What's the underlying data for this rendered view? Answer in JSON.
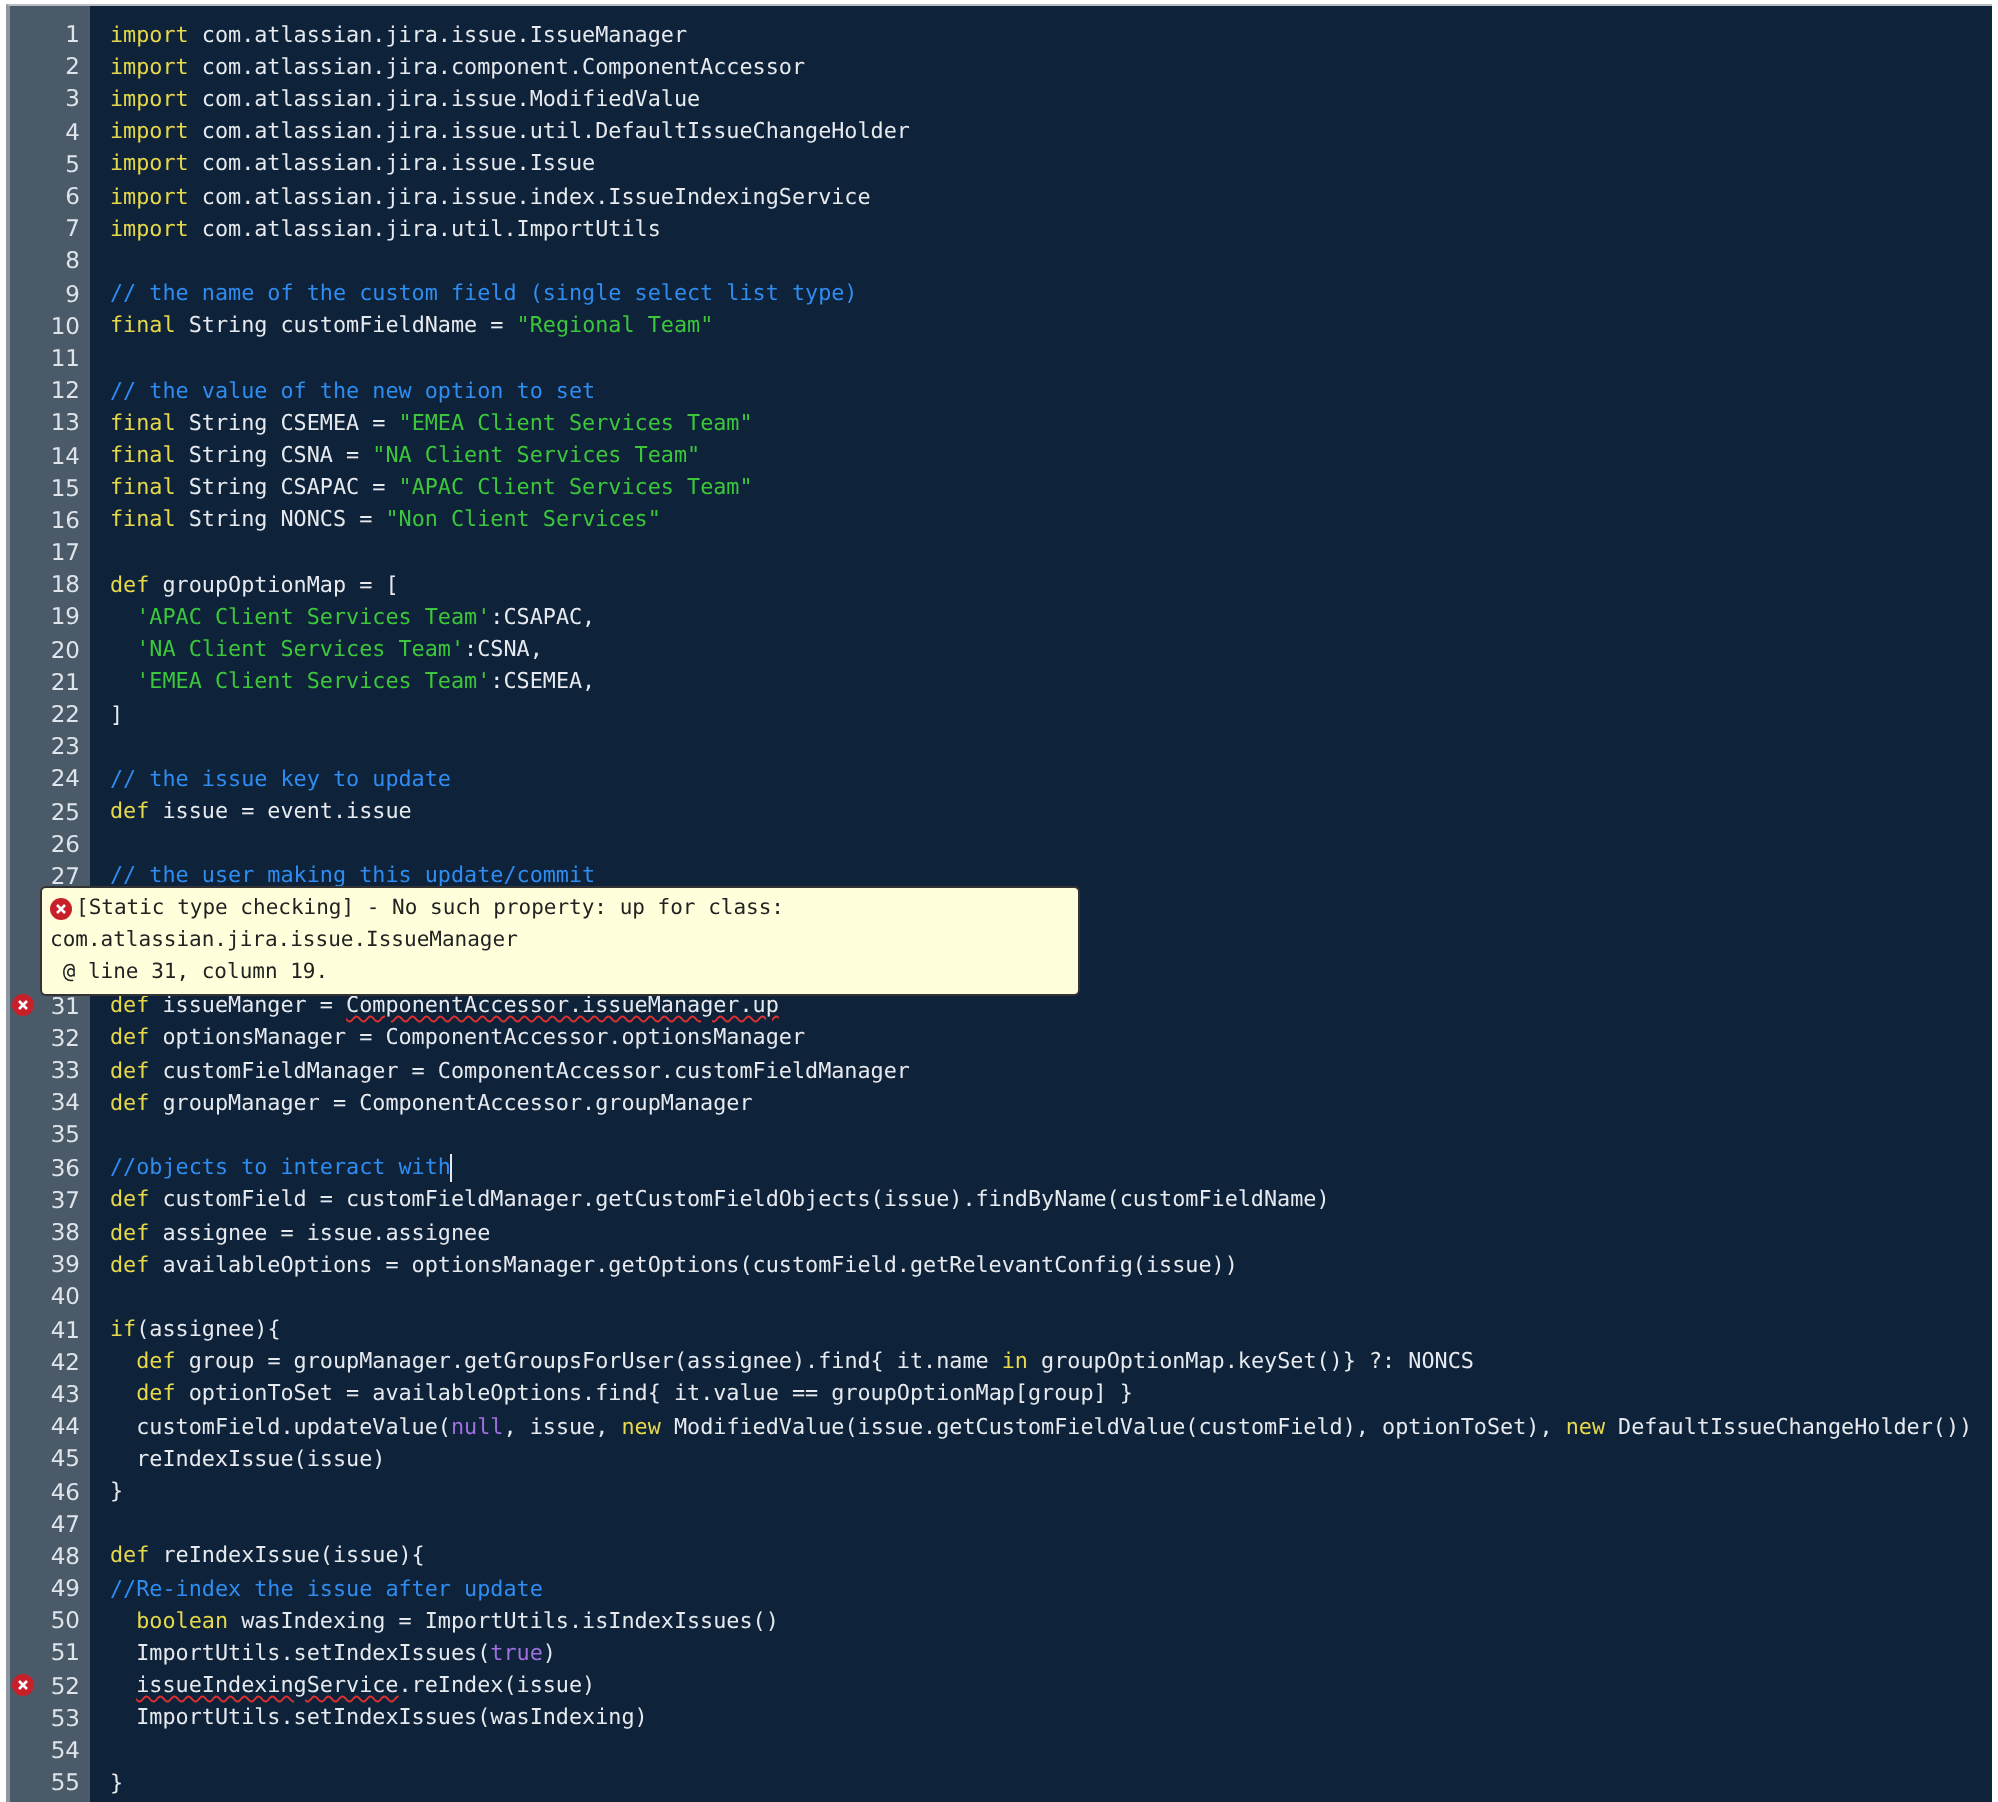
{
  "editor": {
    "lines": [
      {
        "number": "1",
        "error": false,
        "segments": [
          {
            "kind": "keyword",
            "text": "import"
          },
          {
            "kind": "plain",
            "text": " com.atlassian.jira.issue.IssueManager"
          }
        ]
      },
      {
        "number": "2",
        "error": false,
        "segments": [
          {
            "kind": "keyword",
            "text": "import"
          },
          {
            "kind": "plain",
            "text": " com.atlassian.jira.component.ComponentAccessor"
          }
        ]
      },
      {
        "number": "3",
        "error": false,
        "segments": [
          {
            "kind": "keyword",
            "text": "import"
          },
          {
            "kind": "plain",
            "text": " com.atlassian.jira.issue.ModifiedValue"
          }
        ]
      },
      {
        "number": "4",
        "error": false,
        "segments": [
          {
            "kind": "keyword",
            "text": "import"
          },
          {
            "kind": "plain",
            "text": " com.atlassian.jira.issue.util.DefaultIssueChangeHolder"
          }
        ]
      },
      {
        "number": "5",
        "error": false,
        "segments": [
          {
            "kind": "keyword",
            "text": "import"
          },
          {
            "kind": "plain",
            "text": " com.atlassian.jira.issue.Issue"
          }
        ]
      },
      {
        "number": "6",
        "error": false,
        "segments": [
          {
            "kind": "keyword",
            "text": "import"
          },
          {
            "kind": "plain",
            "text": " com.atlassian.jira.issue.index.IssueIndexingService"
          }
        ]
      },
      {
        "number": "7",
        "error": false,
        "segments": [
          {
            "kind": "keyword",
            "text": "import"
          },
          {
            "kind": "plain",
            "text": " com.atlassian.jira.util.ImportUtils"
          }
        ]
      },
      {
        "number": "8",
        "error": false
      },
      {
        "number": "9",
        "error": false,
        "segments": [
          {
            "kind": "comment",
            "text": "// the name of the custom field (single select list type)"
          }
        ]
      },
      {
        "number": "10",
        "error": false,
        "segments": [
          {
            "kind": "keyword",
            "text": "final"
          },
          {
            "kind": "plain",
            "text": " String customFieldName = "
          },
          {
            "kind": "string",
            "text": "\"Regional Team\""
          }
        ]
      },
      {
        "number": "11",
        "error": false
      },
      {
        "number": "12",
        "error": false,
        "segments": [
          {
            "kind": "comment",
            "text": "// the value of the new option to set"
          }
        ]
      },
      {
        "number": "13",
        "error": false,
        "segments": [
          {
            "kind": "keyword",
            "text": "final"
          },
          {
            "kind": "plain",
            "text": " String CSEMEA = "
          },
          {
            "kind": "string",
            "text": "\"EMEA Client Services Team\""
          }
        ]
      },
      {
        "number": "14",
        "error": false,
        "segments": [
          {
            "kind": "keyword",
            "text": "final"
          },
          {
            "kind": "plain",
            "text": " String CSNA = "
          },
          {
            "kind": "string",
            "text": "\"NA Client Services Team\""
          }
        ]
      },
      {
        "number": "15",
        "error": false,
        "segments": [
          {
            "kind": "keyword",
            "text": "final"
          },
          {
            "kind": "plain",
            "text": " String CSAPAC = "
          },
          {
            "kind": "string",
            "text": "\"APAC Client Services Team\""
          }
        ]
      },
      {
        "number": "16",
        "error": false,
        "segments": [
          {
            "kind": "keyword",
            "text": "final"
          },
          {
            "kind": "plain",
            "text": " String NONCS = "
          },
          {
            "kind": "string",
            "text": "\"Non Client Services\""
          }
        ]
      },
      {
        "number": "17",
        "error": false
      },
      {
        "number": "18",
        "error": false,
        "segments": [
          {
            "kind": "keyword",
            "text": "def"
          },
          {
            "kind": "plain",
            "text": " groupOptionMap = ["
          }
        ]
      },
      {
        "number": "19",
        "error": false,
        "segments": [
          {
            "kind": "string",
            "text": "  'APAC Client Services Team'"
          },
          {
            "kind": "plain",
            "text": ":CSAPAC,"
          }
        ]
      },
      {
        "number": "20",
        "error": false,
        "segments": [
          {
            "kind": "string",
            "text": "  'NA Client Services Team'"
          },
          {
            "kind": "plain",
            "text": ":CSNA,"
          }
        ]
      },
      {
        "number": "21",
        "error": false,
        "segments": [
          {
            "kind": "string",
            "text": "  'EMEA Client Services Team'"
          },
          {
            "kind": "plain",
            "text": ":CSEMEA,"
          }
        ]
      },
      {
        "number": "22",
        "error": false,
        "segments": [
          {
            "kind": "plain",
            "text": "]"
          }
        ]
      },
      {
        "number": "23",
        "error": false
      },
      {
        "number": "24",
        "error": false,
        "segments": [
          {
            "kind": "comment",
            "text": "// the issue key to update"
          }
        ]
      },
      {
        "number": "25",
        "error": false,
        "segments": [
          {
            "kind": "keyword",
            "text": "def"
          },
          {
            "kind": "plain",
            "text": " issue = event.issue"
          }
        ]
      },
      {
        "number": "26",
        "error": false
      },
      {
        "number": "27",
        "error": false,
        "segments": [
          {
            "kind": "comment",
            "text": "// the user making this update/commit"
          }
        ]
      },
      {
        "number": "31",
        "error": true,
        "segments": [
          {
            "kind": "keyword",
            "text": "def"
          },
          {
            "kind": "plain",
            "text": " issueManger = "
          },
          {
            "kind": "plain",
            "text": "ComponentAccessor.issueManager.up",
            "squiggle": true
          }
        ]
      },
      {
        "number": "32",
        "error": false,
        "segments": [
          {
            "kind": "keyword",
            "text": "def"
          },
          {
            "kind": "plain",
            "text": " optionsManager = ComponentAccessor.optionsManager"
          }
        ]
      },
      {
        "number": "33",
        "error": false,
        "segments": [
          {
            "kind": "keyword",
            "text": "def"
          },
          {
            "kind": "plain",
            "text": " customFieldManager = ComponentAccessor.customFieldManager"
          }
        ]
      },
      {
        "number": "34",
        "error": false,
        "segments": [
          {
            "kind": "keyword",
            "text": "def"
          },
          {
            "kind": "plain",
            "text": " groupManager = ComponentAccessor.groupManager"
          }
        ]
      },
      {
        "number": "35",
        "error": false
      },
      {
        "number": "36",
        "error": false,
        "cursor": true,
        "segments": [
          {
            "kind": "comment",
            "text": "//objects to interact with"
          }
        ]
      },
      {
        "number": "37",
        "error": false,
        "segments": [
          {
            "kind": "keyword",
            "text": "def"
          },
          {
            "kind": "plain",
            "text": " customField = customFieldManager.getCustomFieldObjects(issue).findByName(customFieldName)"
          }
        ]
      },
      {
        "number": "38",
        "error": false,
        "segments": [
          {
            "kind": "keyword",
            "text": "def"
          },
          {
            "kind": "plain",
            "text": " assignee = issue.assignee"
          }
        ]
      },
      {
        "number": "39",
        "error": false,
        "segments": [
          {
            "kind": "keyword",
            "text": "def"
          },
          {
            "kind": "plain",
            "text": " availableOptions = optionsManager.getOptions(customField.getRelevantConfig(issue))"
          }
        ]
      },
      {
        "number": "40",
        "error": false
      },
      {
        "number": "41",
        "error": false,
        "segments": [
          {
            "kind": "keyword",
            "text": "if"
          },
          {
            "kind": "plain",
            "text": "(assignee){"
          }
        ]
      },
      {
        "number": "42",
        "error": false,
        "segments": [
          {
            "kind": "keyword",
            "text": "  def"
          },
          {
            "kind": "plain",
            "text": " group = groupManager.getGroupsForUser(assignee).find{ it.name "
          },
          {
            "kind": "keyword",
            "text": "in"
          },
          {
            "kind": "plain",
            "text": " groupOptionMap.keySet()} ?: NONCS"
          }
        ]
      },
      {
        "number": "43",
        "error": false,
        "segments": [
          {
            "kind": "keyword",
            "text": "  def"
          },
          {
            "kind": "plain",
            "text": " optionToSet = availableOptions.find{ it.value == groupOptionMap[group] }"
          }
        ]
      },
      {
        "number": "44",
        "error": false,
        "segments": [
          {
            "kind": "plain",
            "text": "  customField.updateValue("
          },
          {
            "kind": "literal",
            "text": "null"
          },
          {
            "kind": "plain",
            "text": ", issue, "
          },
          {
            "kind": "keyword",
            "text": "new"
          },
          {
            "kind": "plain",
            "text": " ModifiedValue(issue.getCustomFieldValue(customField), optionToSet), "
          },
          {
            "kind": "keyword",
            "text": "new"
          },
          {
            "kind": "plain",
            "text": " DefaultIssueChangeHolder())"
          }
        ]
      },
      {
        "number": "45",
        "error": false,
        "segments": [
          {
            "kind": "plain",
            "text": "  reIndexIssue(issue)"
          }
        ]
      },
      {
        "number": "46",
        "error": false,
        "segments": [
          {
            "kind": "plain",
            "text": "}"
          }
        ]
      },
      {
        "number": "47",
        "error": false
      },
      {
        "number": "48",
        "error": false,
        "segments": [
          {
            "kind": "keyword",
            "text": "def"
          },
          {
            "kind": "plain",
            "text": " reIndexIssue(issue){"
          }
        ]
      },
      {
        "number": "49",
        "error": false,
        "segments": [
          {
            "kind": "comment",
            "text": "//Re-index the issue after update"
          }
        ]
      },
      {
        "number": "50",
        "error": false,
        "segments": [
          {
            "kind": "keyword",
            "text": "  boolean"
          },
          {
            "kind": "plain",
            "text": " wasIndexing = ImportUtils.isIndexIssues()"
          }
        ]
      },
      {
        "number": "51",
        "error": false,
        "segments": [
          {
            "kind": "plain",
            "text": "  ImportUtils.setIndexIssues("
          },
          {
            "kind": "literal",
            "text": "true"
          },
          {
            "kind": "plain",
            "text": ")"
          }
        ]
      },
      {
        "number": "52",
        "error": true,
        "indented": true,
        "segments": [
          {
            "kind": "plain",
            "text": "issueIndexingService",
            "squiggle": true
          },
          {
            "kind": "plain",
            "text": ".reIndex(issue)"
          }
        ]
      },
      {
        "number": "53",
        "error": false,
        "segments": [
          {
            "kind": "plain",
            "text": "  ImportUtils.setIndexIssues(wasIndexing)"
          }
        ]
      },
      {
        "number": "54",
        "error": false
      },
      {
        "number": "55",
        "error": false,
        "segments": [
          {
            "kind": "plain",
            "text": "}"
          }
        ]
      }
    ]
  },
  "tooltip": {
    "lines": [
      "[Static type checking] - No such property: up for class:",
      "com.atlassian.jira.issue.IssueManager",
      " @ line 31, column 19."
    ]
  }
}
